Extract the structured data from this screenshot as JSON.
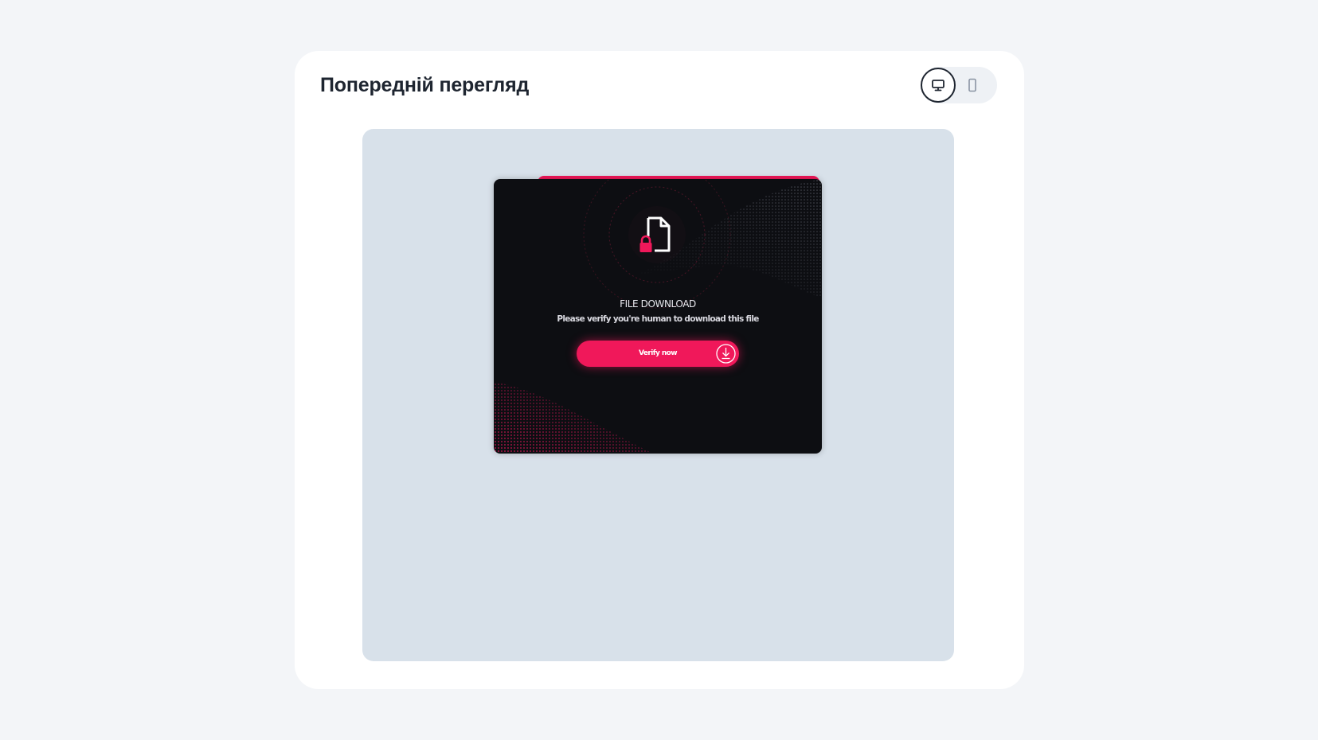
{
  "header": {
    "title": "Попередній перегляд"
  },
  "device_toggle": {
    "options": [
      {
        "name": "desktop",
        "icon": "monitor-icon",
        "active": true
      },
      {
        "name": "mobile",
        "icon": "smartphone-icon",
        "active": false
      }
    ]
  },
  "preview": {
    "popup": {
      "title": "FILE DOWNLOAD",
      "subtitle": "Please verify you're human to download this file",
      "button_label": "Verify now",
      "button_icon": "download-circle-icon",
      "file_icon": "locked-file-icon"
    }
  },
  "colors": {
    "accent": "#f0185a",
    "popup_background": "#0d0e12",
    "preview_background": "#d8e1ea",
    "page_background": "#f3f5f8"
  }
}
